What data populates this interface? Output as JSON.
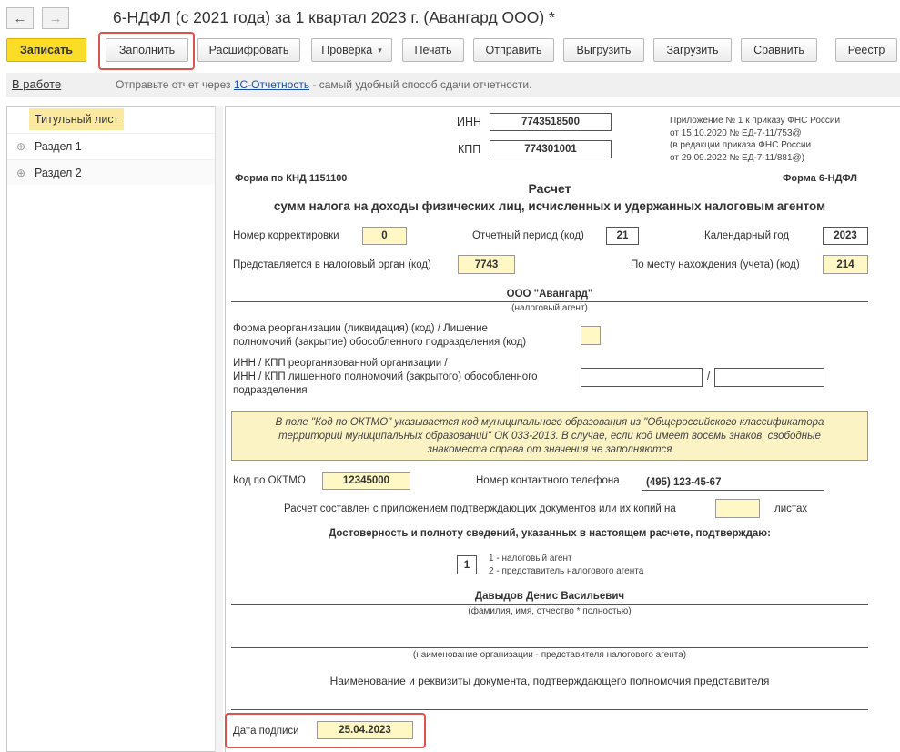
{
  "window": {
    "title": "6-НДФЛ (с 2021 года) за 1 квартал 2023 г. (Авангард ООО) *",
    "back_icon": "←",
    "forward_icon": "→"
  },
  "toolbar": {
    "save": "Записать",
    "fill": "Заполнить",
    "decode": "Расшифровать",
    "check": "Проверка",
    "check_arrow": "▾",
    "print": "Печать",
    "send": "Отправить",
    "export": "Выгрузить",
    "import": "Загрузить",
    "compare": "Сравнить",
    "registry": "Реестр"
  },
  "status": {
    "state": "В работе",
    "hint_before": "Отправьте отчет через ",
    "hint_link": "1С-Отчетность",
    "hint_after": " - самый удобный способ сдачи отчетности."
  },
  "tree": {
    "items": [
      {
        "label": "Титульный лист",
        "expander": ""
      },
      {
        "label": "Раздел 1",
        "expander": "⊕"
      },
      {
        "label": "Раздел 2",
        "expander": "⊕"
      }
    ]
  },
  "form": {
    "inn_label": "ИНН",
    "inn": "7743518500",
    "kpp_label": "КПП",
    "kpp": "774301001",
    "appendix": [
      "Приложение № 1 к приказу ФНС России",
      "от 15.10.2020 № ЕД-7-11/753@",
      "(в редакции приказа ФНС России",
      "от 29.09.2022 № ЕД-7-11/881@)"
    ],
    "knd": "Форма по КНД 1151100",
    "form_name": "Форма 6-НДФЛ",
    "heading1": "Расчет",
    "heading2": "сумм налога на доходы физических лиц, исчисленных и удержанных налоговым агентом",
    "correction_label": "Номер корректировки",
    "correction": "0",
    "period_label": "Отчетный период (код)",
    "period": "21",
    "year_label": "Календарный год",
    "year": "2023",
    "tax_org_label": "Представляется в налоговый орган (код)",
    "tax_org": "7743",
    "location_label": "По месту нахождения (учета) (код)",
    "location": "214",
    "agent_name": "ООО \"Авангард\"",
    "agent_caption": "(налоговый агент)",
    "reorg_label1": "Форма реорганизации (ликвидация) (код) / Лишение",
    "reorg_label2": "полномочий (закрытие) обособленного подразделения (код)",
    "reorg_inn_label1": "ИНН / КПП реорганизованной организации /",
    "reorg_inn_label2": "ИНН / КПП лишенного полномочий (закрытого) обособленного",
    "reorg_inn_label3": "подразделения",
    "slash": "/",
    "note1": "В поле \"Код по ОКТМО\" указывается код муниципального образования из \"Общероссийского классификатора",
    "note2": "территорий муниципальных образований\" ОК 033-2013. В случае, если код имеет восемь знаков, свободные",
    "note3": "знакоместа справа от значения не заполняются",
    "oktmo_label": "Код по ОКТМО",
    "oktmo": "12345000",
    "phone_label": "Номер контактного телефона",
    "phone": "(495) 123-45-67",
    "appendix_docs_label": "Расчет составлен с приложением подтверждающих документов или их копий на",
    "sheets_label": "листах",
    "confirm": "Достоверность и полноту сведений, указанных в настоящем расчете, подтверждаю:",
    "signer_code": "1",
    "signer_opt1": "1 - налоговый агент",
    "signer_opt2": "2 - представитель налогового агента",
    "signer_name": "Давыдов Денис Васильевич",
    "signer_caption": "(фамилия, имя, отчество * полностью)",
    "org_caption": "(наименование организации - представителя налогового агента)",
    "proxy_doc": "Наименование и реквизиты документа, подтверждающего полномочия представителя",
    "sign_date_label": "Дата подписи",
    "sign_date": "25.04.2023"
  },
  "colors": {
    "accent_yellow": "#fbdc26",
    "field_yellow": "#fff8c4",
    "highlight_red": "#d9534f",
    "link_blue": "#1a4fa0"
  }
}
